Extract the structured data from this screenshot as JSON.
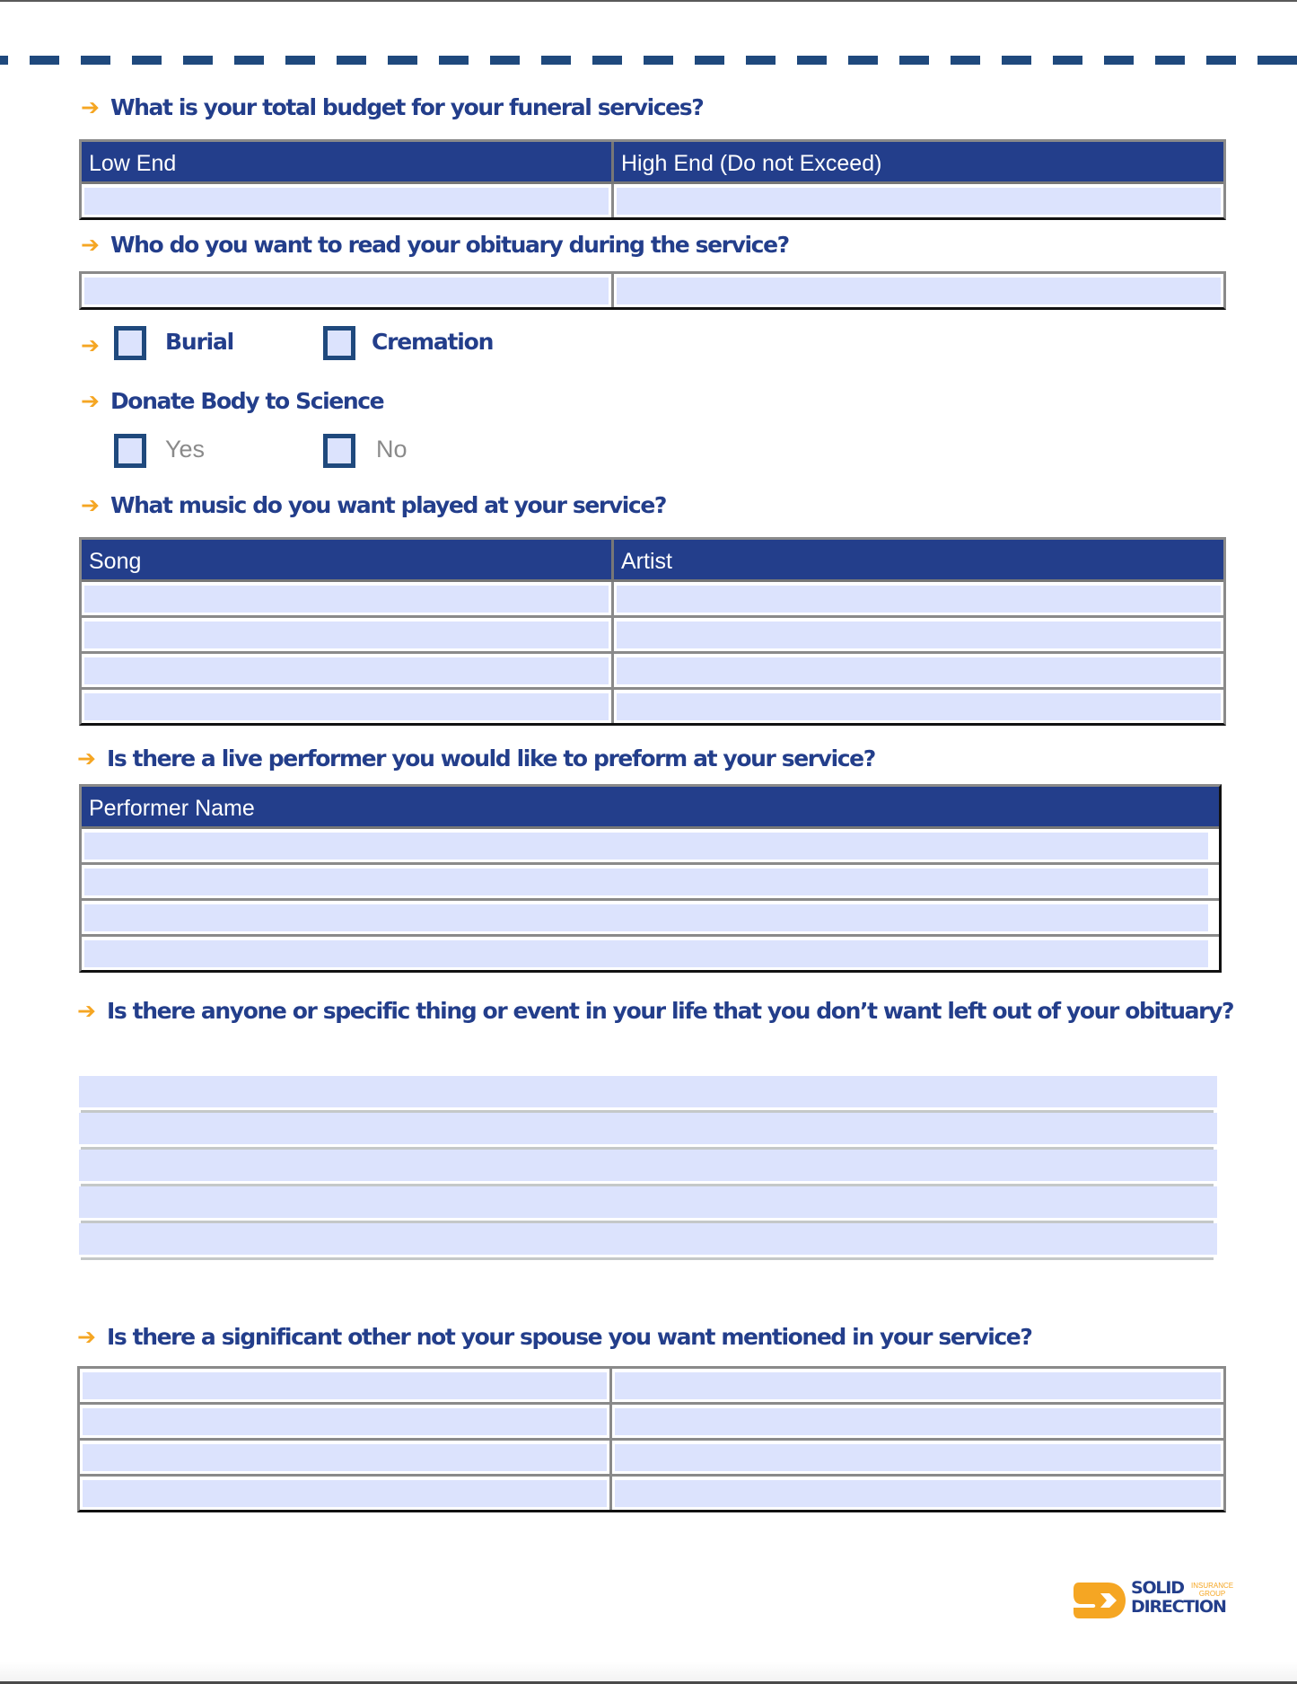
{
  "document": {
    "arrow_glyph": "➔",
    "q1": {
      "label": "What is your total budget for your funeral services?",
      "columns": [
        "Low End",
        "High End (Do not Exceed)"
      ],
      "rows": [
        [
          "",
          ""
        ]
      ]
    },
    "q2": {
      "label": "Who do you want to read your obituary during the service?",
      "rows": [
        [
          "",
          ""
        ]
      ]
    },
    "disposition": {
      "options": [
        {
          "label": "Burial",
          "checked": false
        },
        {
          "label": "Cremation",
          "checked": false
        }
      ]
    },
    "donate": {
      "label": "Donate Body to Science",
      "options": [
        {
          "label": "Yes",
          "checked": false
        },
        {
          "label": "No",
          "checked": false
        }
      ]
    },
    "q3": {
      "label": "What music do you want played at your service?",
      "columns": [
        "Song",
        "Artist"
      ],
      "rows": [
        [
          "",
          ""
        ],
        [
          "",
          ""
        ],
        [
          "",
          ""
        ],
        [
          "",
          ""
        ]
      ]
    },
    "q4": {
      "label": "Is there a live performer you would like to preform at your service?",
      "columns": [
        "Performer Name"
      ],
      "rows": [
        [
          ""
        ],
        [
          ""
        ],
        [
          ""
        ],
        [
          ""
        ]
      ]
    },
    "q5": {
      "label": "Is there anyone or specific thing or event in your life that you don’t want left out of your obituary?",
      "lines": [
        "",
        "",
        "",
        "",
        ""
      ]
    },
    "q6": {
      "label": "Is there a significant other not your spouse you want mentioned in your service?",
      "rows": [
        [
          "",
          ""
        ],
        [
          "",
          ""
        ],
        [
          "",
          ""
        ],
        [
          "",
          ""
        ]
      ]
    }
  },
  "logo": {
    "line1": "SOLID",
    "line2": "DIRECTION",
    "tag1": "INSURANCE",
    "tag2": "GROUP",
    "colors": {
      "navy": "#233e8b",
      "orange": "#f5a623"
    }
  },
  "colors": {
    "header_bg": "#233e8b",
    "field_fill": "#dce3fd",
    "arrow": "#f5a623",
    "question_text": "#233e8b",
    "dash": "#1f497d"
  }
}
